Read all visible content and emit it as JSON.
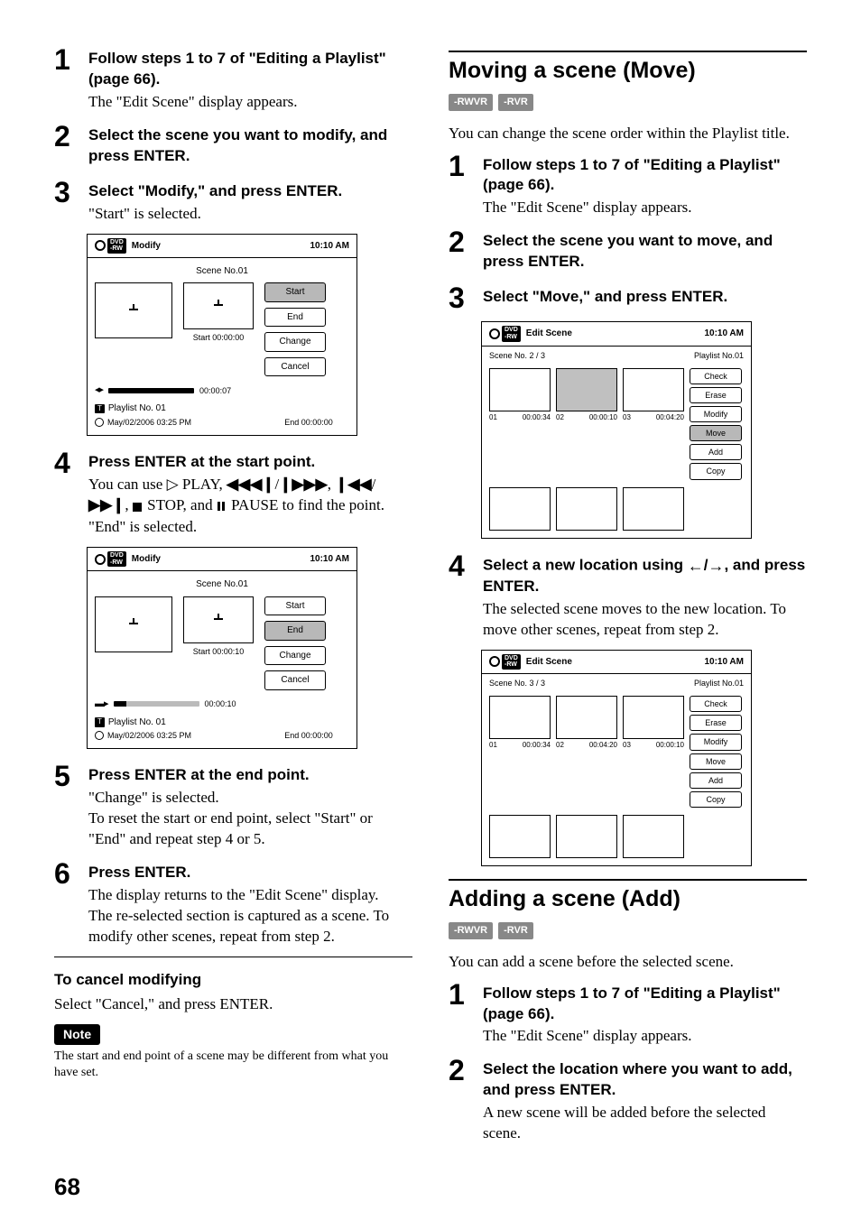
{
  "left": {
    "s1": {
      "title": "Follow steps 1 to 7 of \"Editing a Playlist\" (page 66).",
      "desc": "The \"Edit Scene\" display appears."
    },
    "s2": {
      "title": "Select the scene you want to modify, and press ENTER."
    },
    "s3": {
      "title": "Select \"Modify,\" and press ENTER.",
      "desc": "\"Start\" is selected."
    },
    "s4": {
      "title": "Press ENTER at the start point.",
      "desc1": "You can use ",
      "play": " PLAY, ",
      "rev_fwd_sep": "/",
      "comma1": ", ",
      "skipsep": "/",
      "comma2": ", ",
      "stop": " STOP, and ",
      "pause": " PAUSE to find the point.",
      "desc2": "\"End\" is selected."
    },
    "s5": {
      "title": "Press ENTER at the end point.",
      "desc": "\"Change\" is selected.\nTo reset the start or end point, select \"Start\" or \"End\" and repeat step 4 or 5."
    },
    "s6": {
      "title": "Press ENTER.",
      "desc": "The display returns to the \"Edit Scene\" display.\nThe re-selected section is captured as a scene. To modify other scenes, repeat from step 2."
    },
    "cancel_title": "To cancel modifying",
    "cancel_desc": "Select \"Cancel,\" and press ENTER.",
    "note_label": "Note",
    "note_text": "The start and end point of a scene may be different from what you have set."
  },
  "panelA": {
    "title": "Modify",
    "time": "10:10 AM",
    "scene": "Scene No.01",
    "start_cap": "Start 00:00:00",
    "end_cap": "End   00:00:00",
    "btns": [
      "Start",
      "End",
      "Change",
      "Cancel"
    ],
    "slider_time": "00:00:07",
    "playlist": "Playlist No. 01",
    "date": "May/02/2006  03:25  PM"
  },
  "panelB": {
    "title": "Modify",
    "time": "10:10 AM",
    "scene": "Scene No.01",
    "start_cap": "Start 00:00:10",
    "end_cap": "End   00:00:00",
    "btns": [
      "Start",
      "End",
      "Change",
      "Cancel"
    ],
    "slider_time": "00:00:10",
    "playlist": "Playlist No. 01",
    "date": "May/02/2006  03:25  PM"
  },
  "right": {
    "move": {
      "title": "Moving a scene (Move)",
      "badges": [
        "-RWVR",
        "-RVR"
      ],
      "intro": "You can change the scene order within the Playlist title.",
      "s1": {
        "title": "Follow steps 1 to 7 of \"Editing a Playlist\" (page 66).",
        "desc": "The \"Edit Scene\" display appears."
      },
      "s2": {
        "title": "Select the scene you want to move, and press ENTER."
      },
      "s3": {
        "title": "Select \"Move,\" and press ENTER."
      },
      "s4": {
        "title_a": "Select a new location using ",
        "title_b": ", and press ENTER.",
        "desc": "The selected scene moves to the new location. To move other scenes, repeat from step 2."
      }
    },
    "panelC": {
      "title": "Edit Scene",
      "time": "10:10 AM",
      "sub_left": "Scene No. 2 / 3",
      "sub_right": "Playlist No.01",
      "cells": [
        {
          "n": "01",
          "t": "00:00:34"
        },
        {
          "n": "02",
          "t": "00:00:10",
          "sel": true
        },
        {
          "n": "03",
          "t": "00:04:20"
        }
      ],
      "btns": [
        "Check",
        "Erase",
        "Modify",
        "Move",
        "Add",
        "Copy"
      ],
      "sel_btn": "Move"
    },
    "panelD": {
      "title": "Edit Scene",
      "time": "10:10 AM",
      "sub_left": "Scene No. 3 / 3",
      "sub_right": "Playlist No.01",
      "cells": [
        {
          "n": "01",
          "t": "00:00:34"
        },
        {
          "n": "02",
          "t": "00:04:20"
        },
        {
          "n": "03",
          "t": "00:00:10"
        }
      ],
      "btns": [
        "Check",
        "Erase",
        "Modify",
        "Move",
        "Add",
        "Copy"
      ]
    },
    "add": {
      "title": "Adding a scene (Add)",
      "badges": [
        "-RWVR",
        "-RVR"
      ],
      "intro": "You can add a scene before the selected scene.",
      "s1": {
        "title": "Follow steps 1 to 7 of \"Editing a Playlist\" (page 66).",
        "desc": "The \"Edit Scene\" display appears."
      },
      "s2": {
        "title": "Select the location where you want to add, and press ENTER.",
        "desc": "A new scene will be added before the selected scene."
      }
    }
  },
  "page": "68"
}
